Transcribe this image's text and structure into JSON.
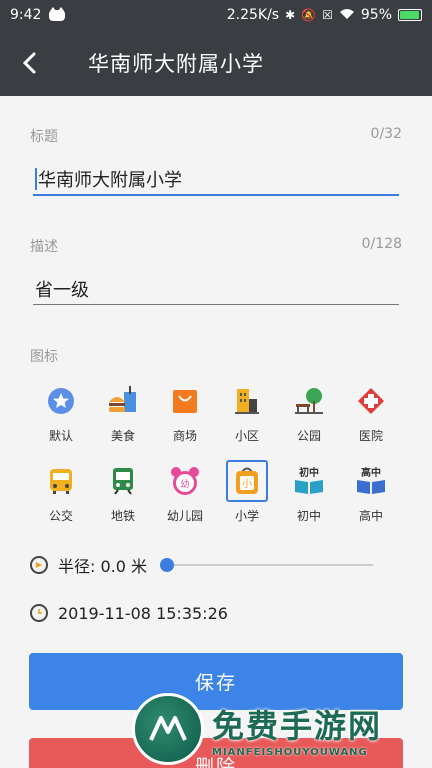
{
  "status_bar": {
    "time": "9:42",
    "speed": "2.25K/s",
    "battery": "95%"
  },
  "toolbar": {
    "title": "华南师大附属小学"
  },
  "form": {
    "title_label": "标题",
    "title_counter": "0/32",
    "title_value": "华南师大附属小学",
    "desc_label": "描述",
    "desc_counter": "0/128",
    "desc_value": "省一级",
    "icon_label": "图标"
  },
  "icons": [
    {
      "label": "默认",
      "icon": "star-badge-icon",
      "selected": false
    },
    {
      "label": "美食",
      "icon": "burger-drink-icon",
      "selected": false
    },
    {
      "label": "商场",
      "icon": "shopping-bag-icon",
      "selected": false
    },
    {
      "label": "小区",
      "icon": "building-icon",
      "selected": false
    },
    {
      "label": "公园",
      "icon": "park-tree-icon",
      "selected": false
    },
    {
      "label": "医院",
      "icon": "hospital-cross-icon",
      "selected": false
    },
    {
      "label": "公交",
      "icon": "bus-icon",
      "selected": false
    },
    {
      "label": "地铁",
      "icon": "subway-icon",
      "selected": false
    },
    {
      "label": "幼儿园",
      "icon": "kindergarten-icon",
      "selected": false
    },
    {
      "label": "小学",
      "icon": "school-bag-icon",
      "selected": true
    },
    {
      "label": "初中",
      "icon": "junior-book-icon",
      "selected": false,
      "badge": "初中"
    },
    {
      "label": "高中",
      "icon": "senior-book-icon",
      "selected": false,
      "badge": "高中"
    }
  ],
  "radius": {
    "text": "半径: 0.0 米",
    "value": 0
  },
  "time": {
    "text": "2019-11-08 15:35:26"
  },
  "buttons": {
    "save": "保存",
    "delete": "删除"
  },
  "watermark": {
    "big": "免费手游网",
    "small": "MIANFEISHOUYOUWANG"
  },
  "colors": {
    "accent": "#3d84e8",
    "danger": "#e85a5a",
    "toolbar": "#3a3d42"
  }
}
